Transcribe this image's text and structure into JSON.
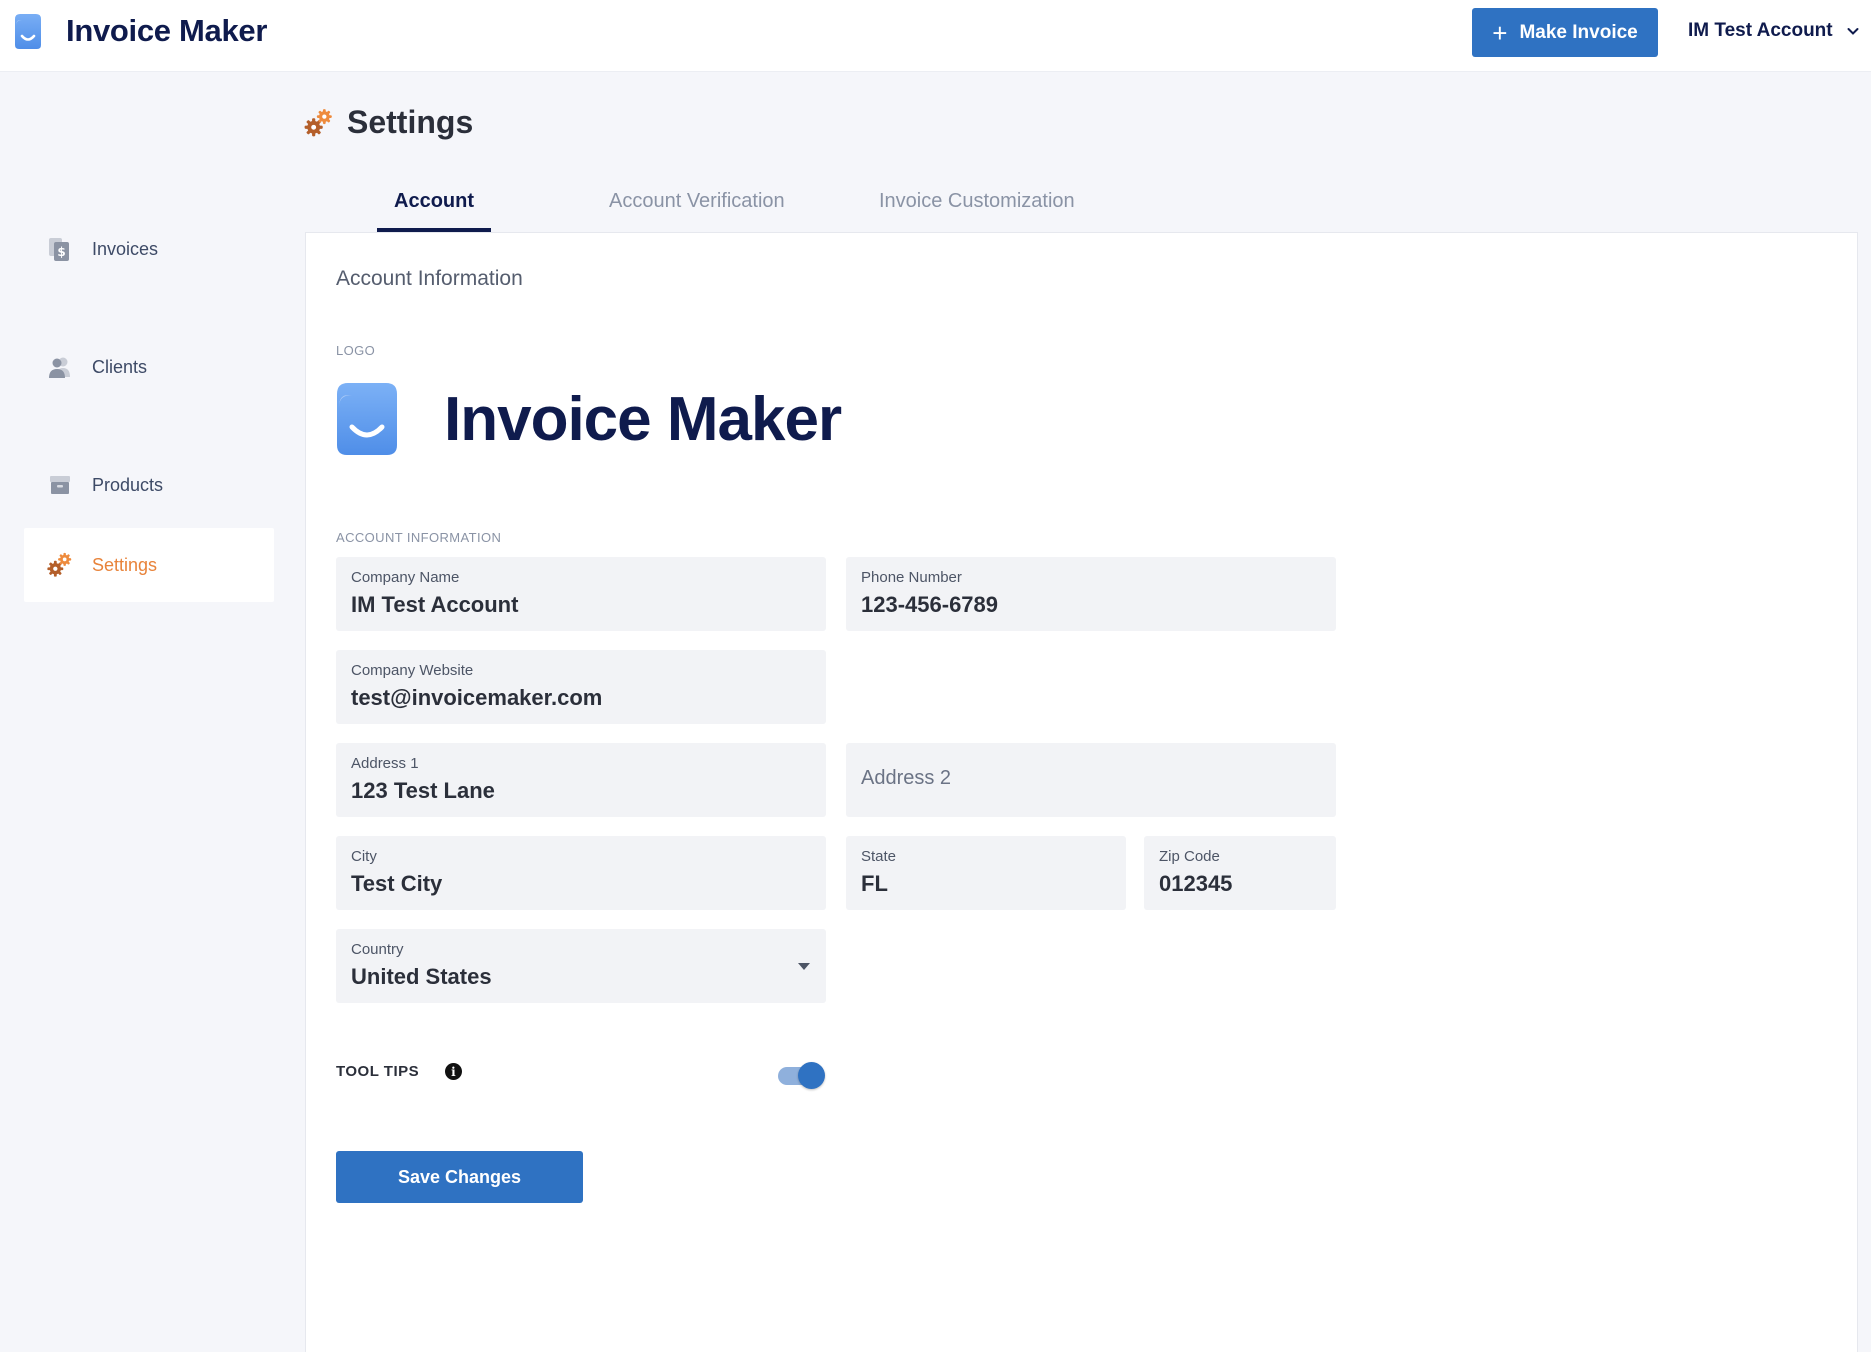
{
  "app": {
    "name": "Invoice Maker"
  },
  "header": {
    "make_invoice_label": "Make Invoice",
    "account_name": "IM Test Account"
  },
  "sidebar": {
    "items": [
      {
        "label": "Invoices",
        "icon": "invoice-icon",
        "active": false
      },
      {
        "label": "Clients",
        "icon": "clients-icon",
        "active": false
      },
      {
        "label": "Products",
        "icon": "products-icon",
        "active": false
      },
      {
        "label": "Settings",
        "icon": "settings-gears-icon",
        "active": true
      }
    ]
  },
  "page": {
    "title": "Settings"
  },
  "tabs": [
    {
      "label": "Account",
      "active": true
    },
    {
      "label": "Account Verification",
      "active": false
    },
    {
      "label": "Invoice Customization",
      "active": false
    }
  ],
  "account": {
    "section_title": "Account Information",
    "logo_label": "LOGO",
    "logo_text": "Invoice Maker",
    "info_label": "ACCOUNT INFORMATION",
    "company_name": {
      "label": "Company Name",
      "value": "IM Test Account"
    },
    "phone_number": {
      "label": "Phone Number",
      "value": "123-456-6789"
    },
    "company_website": {
      "label": "Company Website",
      "value": "test@invoicemaker.com"
    },
    "address1": {
      "label": "Address 1",
      "value": "123 Test Lane"
    },
    "address2": {
      "placeholder": "Address 2"
    },
    "city": {
      "label": "City",
      "value": "Test City"
    },
    "state": {
      "label": "State",
      "value": "FL"
    },
    "zip": {
      "label": "Zip Code",
      "value": "012345"
    },
    "country": {
      "label": "Country",
      "value": "United States"
    },
    "tooltips": {
      "label": "TOOL TIPS",
      "info": "i",
      "enabled": true
    },
    "save_label": "Save Changes"
  },
  "colors": {
    "primary": "#2f72c2",
    "accent_orange": "#e8833a",
    "brand_navy": "#0f1b4d",
    "logo_blue": "#5b9bf0"
  }
}
